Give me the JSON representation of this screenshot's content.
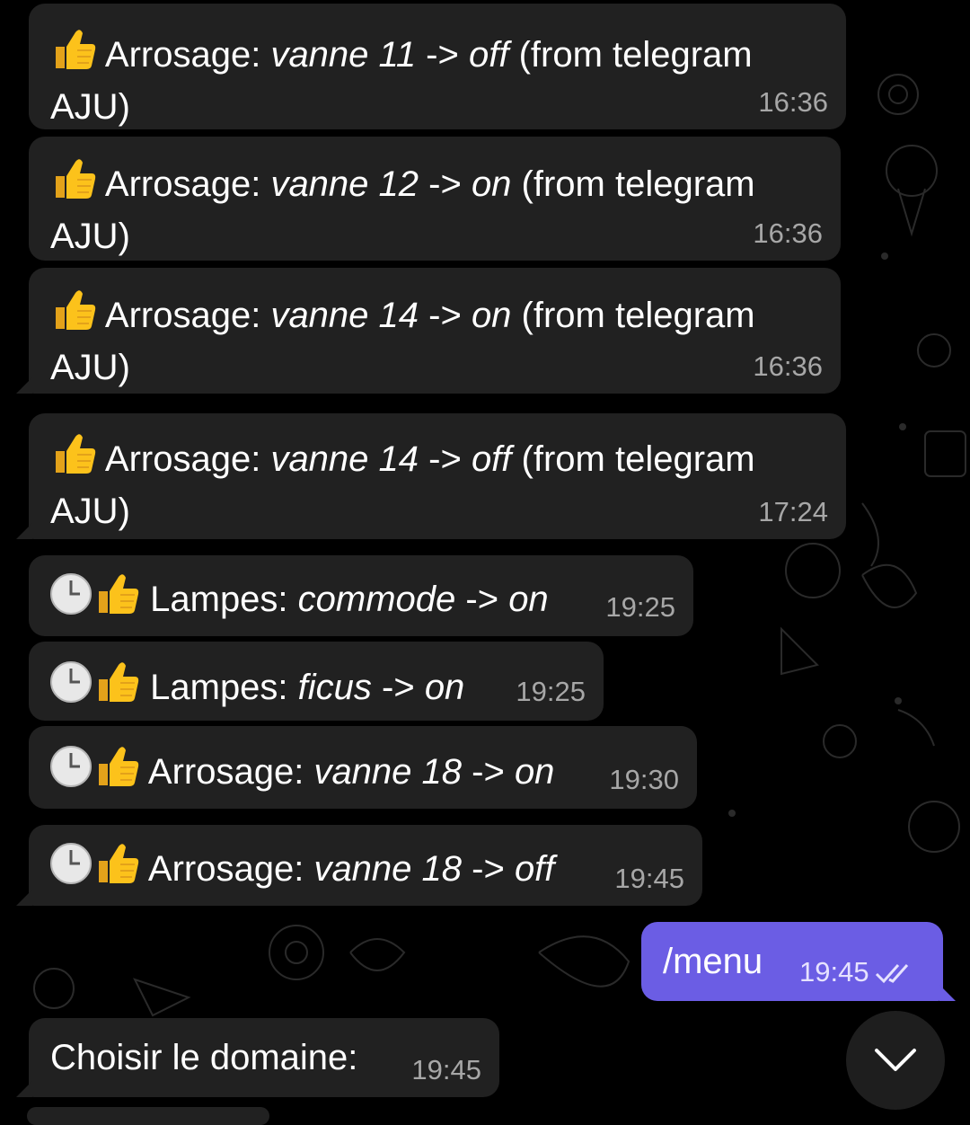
{
  "messages": [
    {
      "prefix": "Arrosage: ",
      "device": "vanne 11",
      "arrow": " -> ",
      "state": "off",
      "suffix": " (from telegram",
      "line2": "AJU)",
      "time": "16:36"
    },
    {
      "prefix": "Arrosage: ",
      "device": "vanne 12",
      "arrow": " -> ",
      "state": "on",
      "suffix": " (from telegram",
      "line2": "AJU)",
      "time": "16:36"
    },
    {
      "prefix": "Arrosage: ",
      "device": "vanne 14",
      "arrow": " -> ",
      "state": "on",
      "suffix": " (from telegram",
      "line2": "AJU)",
      "time": "16:36"
    },
    {
      "prefix": "Arrosage: ",
      "device": "vanne 14",
      "arrow": " -> ",
      "state": "off",
      "suffix": " (from telegram",
      "line2": "AJU)",
      "time": "17:24"
    },
    {
      "prefix": "Lampes: ",
      "device": "commode",
      "arrow": " -> ",
      "state": "on",
      "time": "19:25"
    },
    {
      "prefix": "Lampes: ",
      "device": "ficus",
      "arrow": " -> ",
      "state": "on",
      "time": "19:25"
    },
    {
      "prefix": "Arrosage: ",
      "device": "vanne 18",
      "arrow": " -> ",
      "state": "on",
      "time": "19:30"
    },
    {
      "prefix": "Arrosage: ",
      "device": "vanne 18",
      "arrow": " -> ",
      "state": "off",
      "time": "19:45"
    }
  ],
  "outgoing": {
    "text": "/menu",
    "time": "19:45"
  },
  "reply": {
    "text": "Choisir le domaine:",
    "time": "19:45"
  },
  "colors": {
    "incoming_bubble": "#212121",
    "outgoing_bubble": "#6b5de4",
    "background": "#000000"
  },
  "icons": {
    "thumbs_up": "thumbs-up-icon",
    "clock": "clock-icon",
    "read_receipt": "double-check-icon",
    "scroll_down": "chevron-down-icon"
  }
}
